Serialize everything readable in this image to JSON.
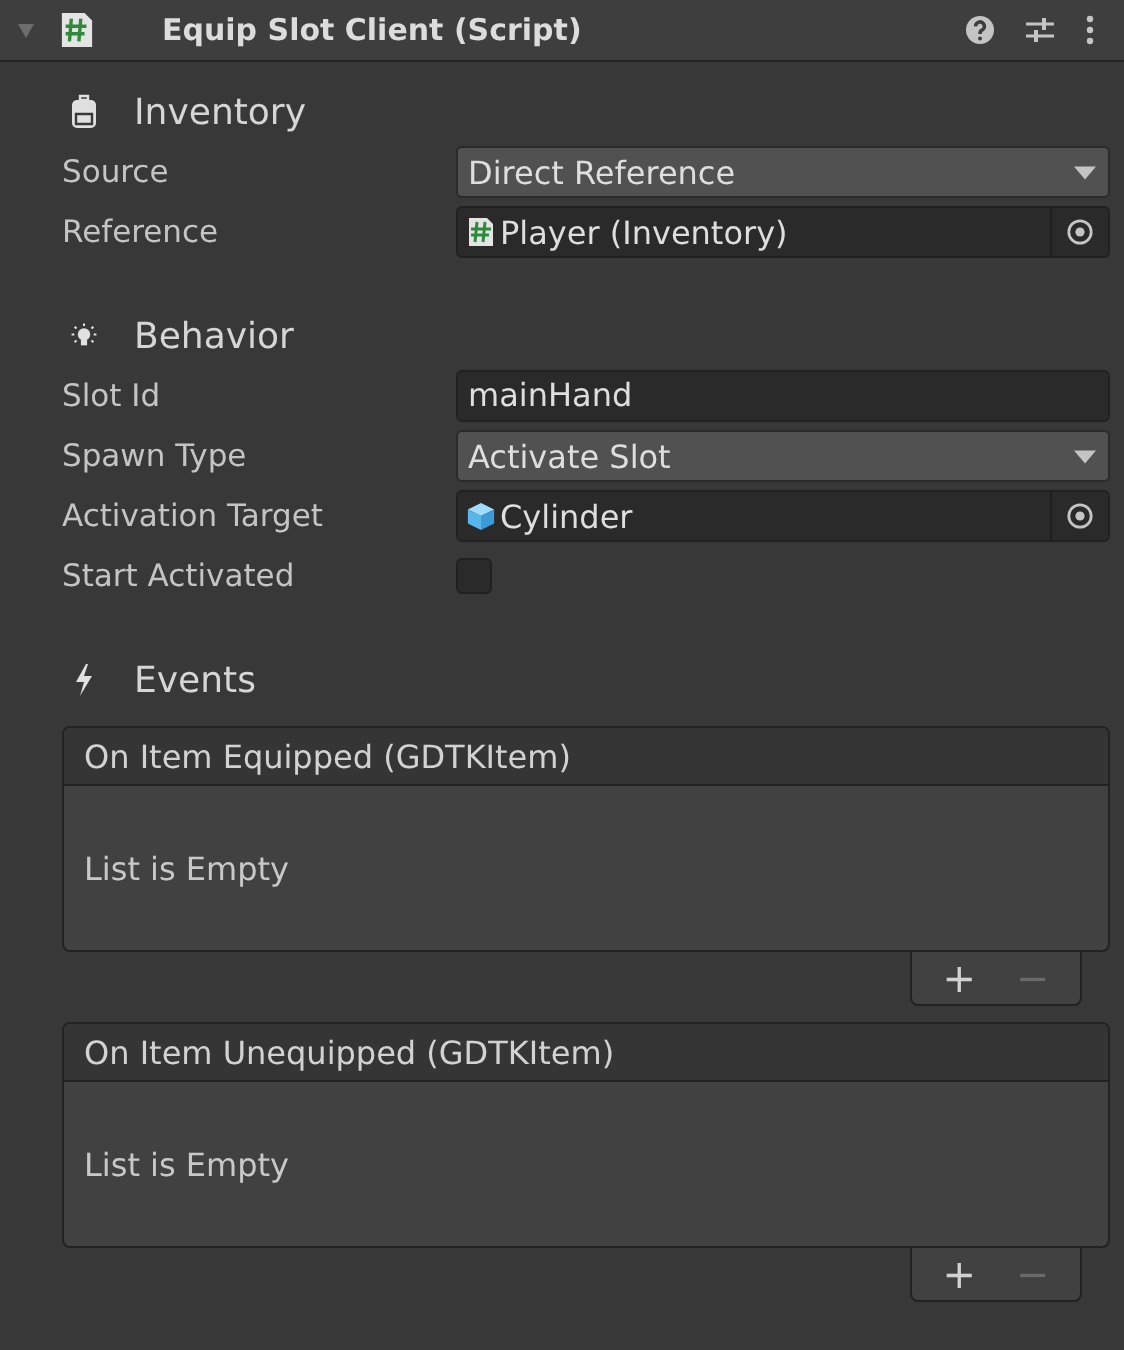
{
  "component": {
    "title": "Equip Slot Client (Script)",
    "expanded": true
  },
  "sections": [
    {
      "title": "Inventory",
      "fields": [
        {
          "label": "Source",
          "kind": "dropdown",
          "value": "Direct Reference"
        },
        {
          "label": "Reference",
          "kind": "object",
          "value": "Player (Inventory)"
        }
      ]
    },
    {
      "title": "Behavior",
      "fields": [
        {
          "label": "Slot Id",
          "kind": "text",
          "value": "mainHand"
        },
        {
          "label": "Spawn Type",
          "kind": "dropdown",
          "value": "Activate Slot"
        },
        {
          "label": "Activation Target",
          "kind": "object",
          "value": "Cylinder"
        },
        {
          "label": "Start Activated",
          "kind": "checkbox",
          "checked": false
        }
      ]
    },
    {
      "title": "Events",
      "events": [
        {
          "title": "On Item Equipped (GDTKItem)",
          "empty_text": "List is Empty",
          "add": "+",
          "remove": "−",
          "remove_disabled": true
        },
        {
          "title": "On Item Unequipped (GDTKItem)",
          "empty_text": "List is Empty",
          "add": "+",
          "remove": "−",
          "remove_disabled": true
        }
      ]
    }
  ]
}
